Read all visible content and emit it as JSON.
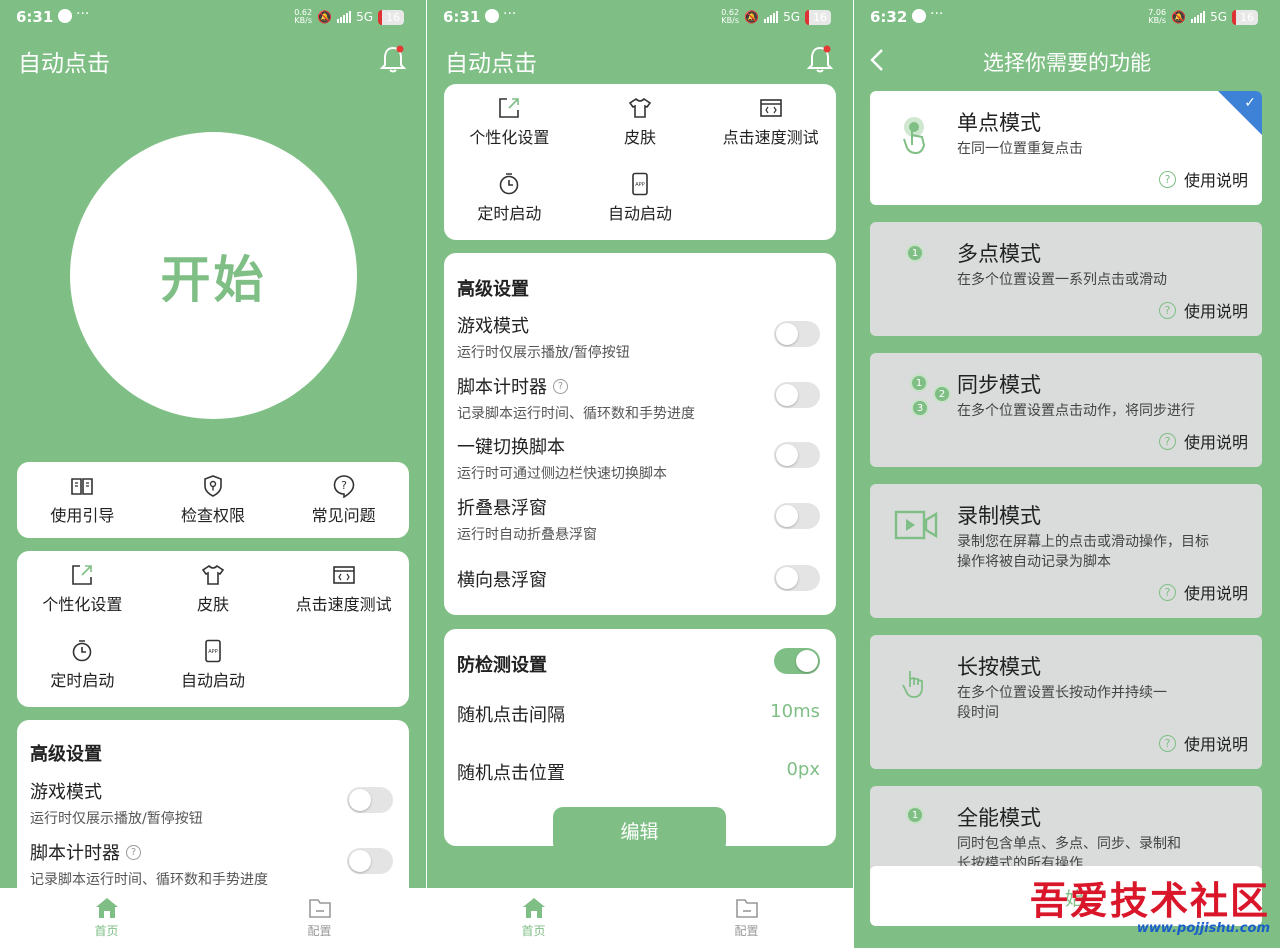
{
  "status": {
    "p1": {
      "time": "6:31",
      "speed": [
        "0.62",
        "KB/s"
      ],
      "network": "5G",
      "battery": "16"
    },
    "p2": {
      "time": "6:31",
      "speed": [
        "0.62",
        "KB/s"
      ],
      "network": "5G",
      "battery": "16"
    },
    "p3": {
      "time": "6:32",
      "speed": [
        "7.06",
        "KB/s"
      ],
      "network": "5G",
      "battery": "16"
    },
    "more": "···"
  },
  "home": {
    "app_title": "自动点击",
    "start_label": "开始",
    "quick": [
      {
        "label": "使用引导",
        "icon": "book-icon"
      },
      {
        "label": "检查权限",
        "icon": "shield-icon"
      },
      {
        "label": "常见问题",
        "icon": "question-bubble-icon"
      }
    ],
    "tools": [
      {
        "label": "个性化设置",
        "icon": "edit-box-icon"
      },
      {
        "label": "皮肤",
        "icon": "tshirt-icon"
      },
      {
        "label": "点击速度测试",
        "icon": "code-window-icon"
      },
      {
        "label": "定时启动",
        "icon": "stopwatch-icon"
      },
      {
        "label": "自动启动",
        "icon": "phone-app-icon"
      }
    ],
    "advanced": {
      "title": "高级设置",
      "items": [
        {
          "title": "游戏模式",
          "sub": "运行时仅展示播放/暂停按钮",
          "on": false
        },
        {
          "title": "脚本计时器",
          "sub": "记录脚本运行时间、循环数和手势进度",
          "on": false,
          "help": true
        },
        {
          "title": "一键切换脚本",
          "sub": "运行时可通过侧边栏快速切换脚本",
          "on": false
        },
        {
          "title": "折叠悬浮窗",
          "sub": "运行时自动折叠悬浮窗",
          "on": false
        },
        {
          "title": "横向悬浮窗",
          "sub": "",
          "on": false
        }
      ]
    },
    "anti": {
      "title": "防检测设置",
      "on": true,
      "interval_label": "随机点击间隔",
      "interval_value": "10ms",
      "position_label": "随机点击位置",
      "position_value": "0px",
      "edit_label": "编辑"
    }
  },
  "tabs": [
    {
      "label": "首页",
      "icon": "home-icon",
      "active": true
    },
    {
      "label": "配置",
      "icon": "folder-icon",
      "active": false
    }
  ],
  "modes": {
    "title": "选择你需要的功能",
    "help_label": "使用说明",
    "items": [
      {
        "title": "单点模式",
        "desc": "在同一位置重复点击",
        "icon": "tap-hand-icon",
        "selected": true
      },
      {
        "title": "多点模式",
        "desc": "在多个位置设置一系列点击或滑动",
        "icon": "numbered-dot-icon",
        "selected": false
      },
      {
        "title": "同步模式",
        "desc": "在多个位置设置点击动作，将同步进行",
        "icon": "multi-dots-icon",
        "selected": false
      },
      {
        "title": "录制模式",
        "desc": "录制您在屏幕上的点击或滑动操作，目标操作将被自动记录为脚本",
        "icon": "video-record-icon",
        "selected": false
      },
      {
        "title": "长按模式",
        "desc": "在多个位置设置长按动作并持续一段时间",
        "icon": "press-hand-icon",
        "selected": false
      },
      {
        "title": "全能模式",
        "desc": "同时包含单点、多点、同步、录制和长按模式的所有操作",
        "icon": "numbered-dot-icon",
        "selected": false
      }
    ],
    "dots": [
      "1",
      "2",
      "3"
    ],
    "check": "✓",
    "bottom_partial": "始"
  },
  "watermark": {
    "main": "吾爱技术社区",
    "url": "www.pojjishu.com"
  },
  "colors": {
    "accent": "#7fbf85",
    "card": "#ffffff",
    "mode_card": "#d9dcdb",
    "selected_corner": "#3d82d6"
  }
}
